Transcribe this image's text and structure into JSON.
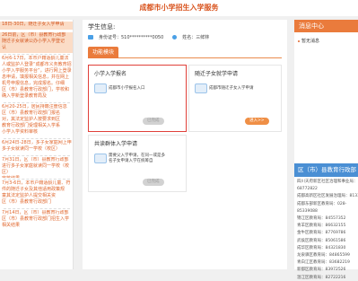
{
  "header": {
    "title": "成都市小学招生入学服务"
  },
  "left_sidebar": {
    "items": [
      {
        "lines": [
          "18日-30日，随迁子女入学申请"
        ],
        "active": true
      },
      {
        "lines": [
          "26日前，区（市）县教育行政部",
          "随迁子女就读公办小学入学登记",
          "认"
        ],
        "active": true
      },
      {
        "lines": [
          "6月6-17日，本市户籍适龄儿童法",
          "人或监护人登录“成都市义务教育招",
          "小学入学服务平台”，进行网上登录",
          "息申请，填报相关信息，并在网上",
          "机号申报信息，完成报名。仔细",
          "区（市）县教育行政部门，学校和",
          "确入学新登录教育局及"
        ],
        "active": false
      },
      {
        "lines": [
          "6月20-25日，居民持籍注册信息",
          "区（市）县教育行政部门报名",
          "对，其法定监护人按要求到区",
          "教育行政部门受理相关入学系",
          "小学入学资料审核"
        ],
        "active": false
      },
      {
        "lines": [
          "6月24日-28日，多子女家庭网上申",
          "多子女就读同一学校（校区）"
        ],
        "active": false
      },
      {
        "lines": [
          "7月31日，区（市）县教育行政部",
          "进行多子女家庭就读同一学校（校区）",
          "审核结果"
        ],
        "active": false
      },
      {
        "lines": [
          "7月3-6日，本市户籍适龄儿童、符",
          "件的随迁子女及其他适用政策规",
          "童其法定监护人提交相关资",
          "区（市）县教育行政部门"
        ],
        "active": false
      },
      {
        "lines": [
          "7月14日，区（市）县教育行政部",
          "区（市）县教育行政部门招生入学",
          "相关结果"
        ],
        "active": false
      }
    ]
  },
  "main": {
    "student_info_title": "学生信息:",
    "id_label": "身份证号：510**********0050",
    "name_label": "姓名：三鲜林",
    "tab_label": "功能模块",
    "cards": [
      {
        "title": "小学入学报名",
        "desc": [
          "成都市小学报名入口"
        ],
        "button": "已完成",
        "button_style": "grey",
        "highlight": true
      },
      {
        "title": "随迁子女就学申请",
        "desc": [
          "成都市随迁子女入学申请"
        ],
        "button": "进入>>",
        "button_style": "orange",
        "highlight": false
      },
      {
        "title": "共读群体入学申请",
        "desc": [
          "需要父入学申请，在同一或是多",
          "名子女申请入学在统筹自"
        ],
        "button": "已完成",
        "button_style": "grey",
        "highlight": false
      }
    ]
  },
  "right_sidebar": {
    "news_title": "消息中心",
    "news_items": [
      "暂无消息"
    ],
    "dept_title": "区（市）县教育行政部",
    "dept_text": [
      "四川天府新区社区治理和事业局：",
      "68772822",
      "成都高新区社区发展治理局：81335",
      "成都东部新区教育局：028-",
      "85339088",
      "锦江区教育局：84557352",
      "青羊区教育局：86632155",
      "金牛区教育局：87769786",
      "武侯区教育局：85061586",
      "成华区教育局：84321830",
      "龙泉驿区教育局：84865599",
      "青白江区教育局：83682219",
      "新都区教育局：83972526",
      "温江区教育局：82722216"
    ]
  }
}
